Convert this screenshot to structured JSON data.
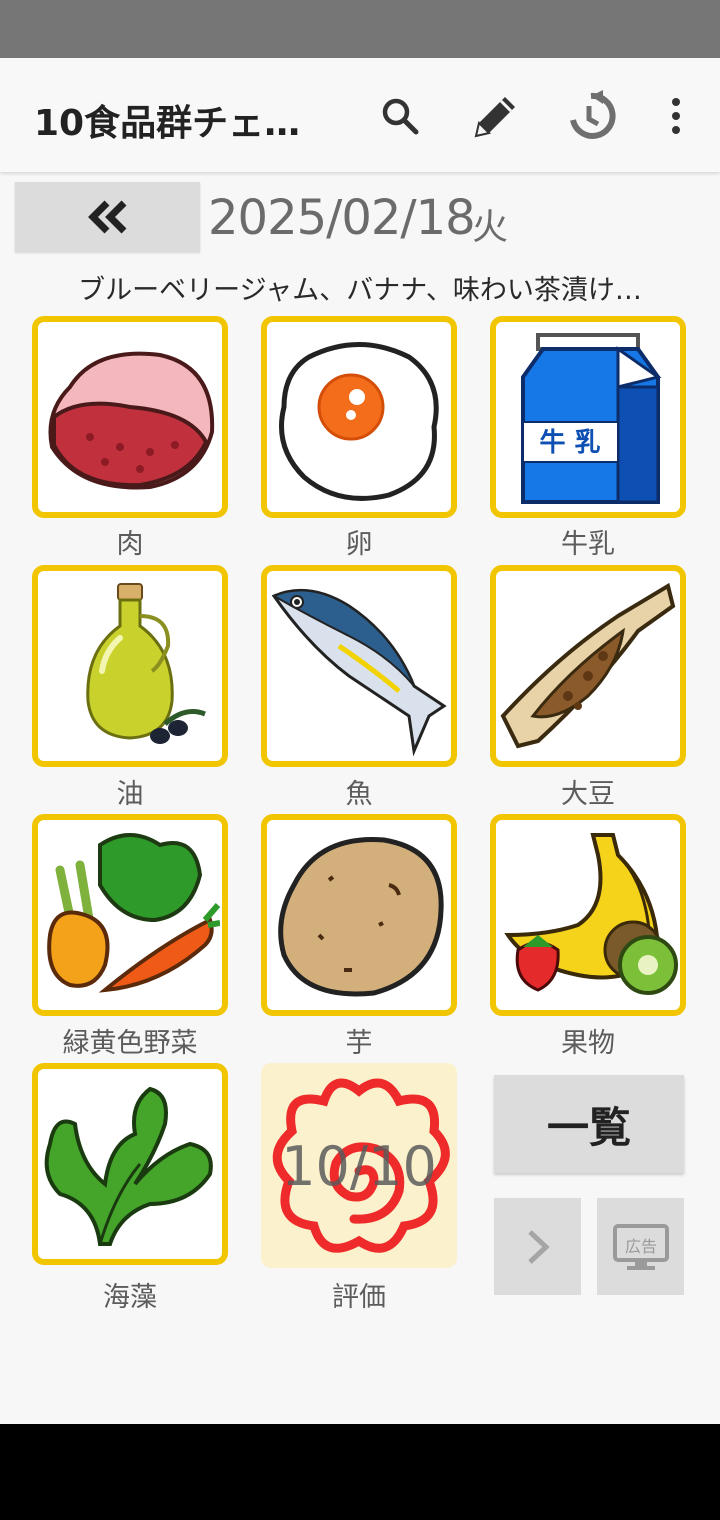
{
  "app_bar": {
    "title": "10食品群チェ…",
    "icons": [
      "search-icon",
      "pencil-icon",
      "history-icon",
      "more-vert-icon"
    ]
  },
  "date_nav": {
    "back_icon": "double-chevron-left-icon",
    "date": "2025/02/18",
    "weekday": "火"
  },
  "meal_summary": "ブルーベリージャム、バナナ、味わい茶漬け…",
  "food_groups": [
    {
      "label": "肉",
      "icon": "meat-icon"
    },
    {
      "label": "卵",
      "icon": "fried-egg-icon"
    },
    {
      "label": "牛乳",
      "icon": "milk-carton-icon",
      "carton_text": "牛 乳"
    },
    {
      "label": "油",
      "icon": "olive-oil-icon"
    },
    {
      "label": "魚",
      "icon": "fish-icon"
    },
    {
      "label": "大豆",
      "icon": "natto-icon"
    },
    {
      "label": "緑黄色野菜",
      "icon": "vegetables-icon"
    },
    {
      "label": "芋",
      "icon": "potato-icon"
    },
    {
      "label": "果物",
      "icon": "fruits-icon"
    },
    {
      "label": "海藻",
      "icon": "seaweed-icon"
    }
  ],
  "evaluation": {
    "label": "評価",
    "score": "10/10",
    "icon": "hanamaru-icon"
  },
  "buttons": {
    "list_label": "一覧",
    "next_icon": "chevron-right-icon",
    "ad_label": "広告",
    "ad_icon": "monitor-ad-icon"
  },
  "colors": {
    "tile_border": "#f1c600",
    "score_bg": "#fbf2cd",
    "hanamaru": "#ee2a2a"
  }
}
